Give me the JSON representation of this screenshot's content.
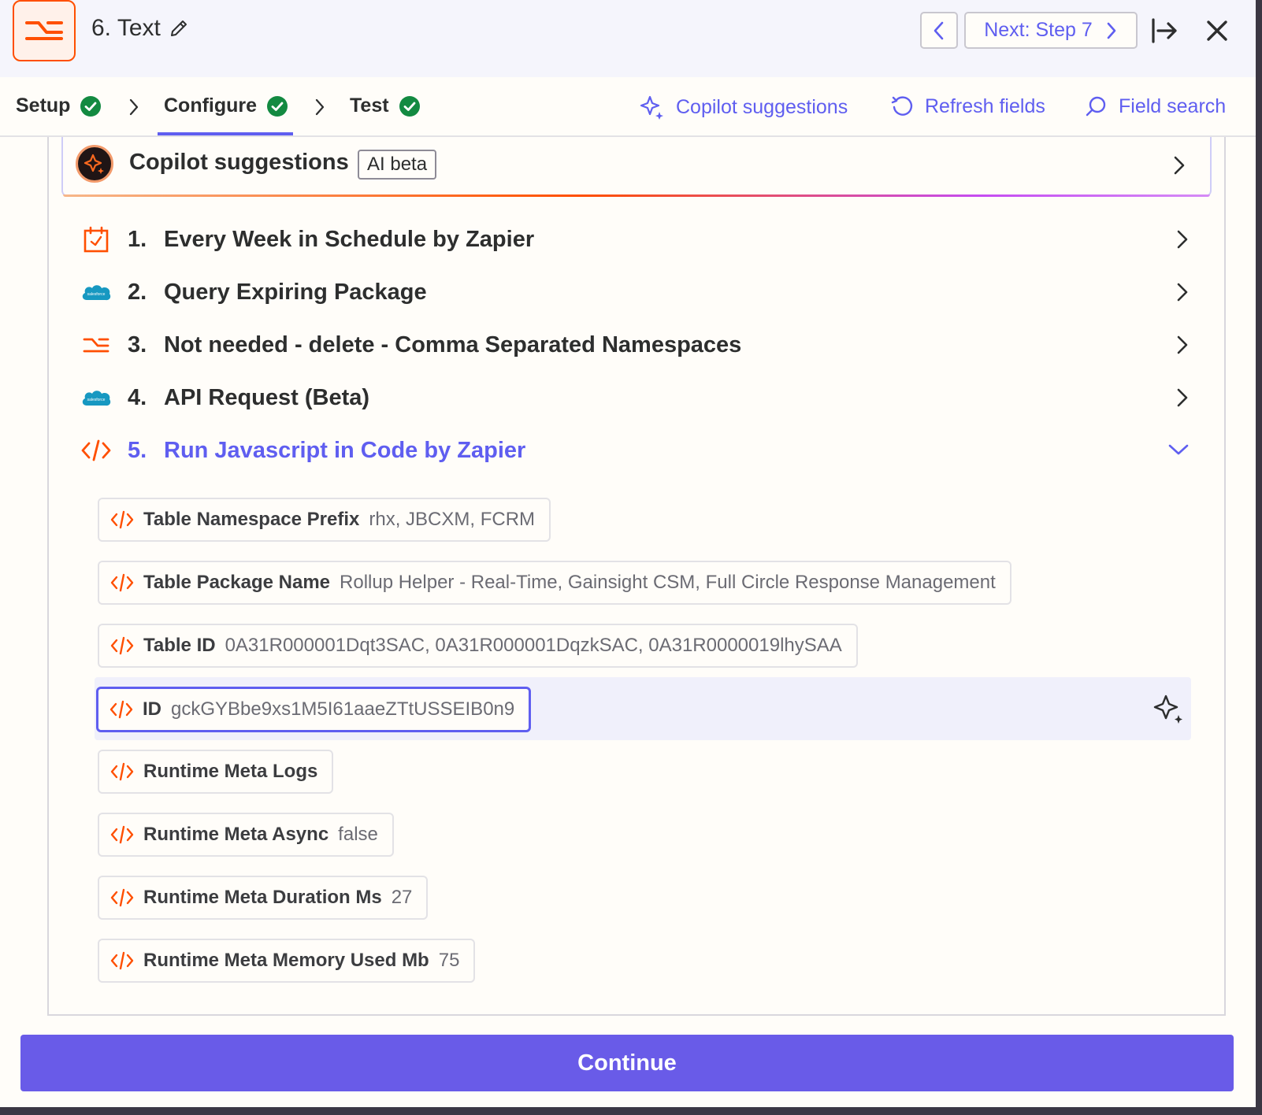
{
  "header": {
    "title": "6. Text",
    "next_label": "Next: Step 7"
  },
  "tabs": [
    {
      "label": "Setup",
      "status": "complete"
    },
    {
      "label": "Configure",
      "status": "complete"
    },
    {
      "label": "Test",
      "status": "complete"
    }
  ],
  "tools": {
    "copilot": "Copilot suggestions",
    "refresh": "Refresh fields",
    "search": "Field search"
  },
  "copilot_card": {
    "title": "Copilot suggestions",
    "badge": "AI beta"
  },
  "steps": [
    {
      "num": "1.",
      "label": "Every Week in Schedule by Zapier",
      "icon": "schedule-icon",
      "expanded": false
    },
    {
      "num": "2.",
      "label": "Query Expiring Package",
      "icon": "salesforce-icon",
      "expanded": false
    },
    {
      "num": "3.",
      "label": "Not needed - delete - Comma Separated Namespaces",
      "icon": "formatter-icon",
      "expanded": false
    },
    {
      "num": "4.",
      "label": "API Request (Beta)",
      "icon": "salesforce-icon",
      "expanded": false
    },
    {
      "num": "5.",
      "label": "Run Javascript in Code by Zapier",
      "icon": "code-icon",
      "expanded": true
    }
  ],
  "fields": [
    {
      "label": "Table Namespace Prefix",
      "value": "rhx, JBCXM, FCRM"
    },
    {
      "label": "Table Package Name",
      "value": "Rollup Helper - Real-Time, Gainsight CSM, Full Circle Response Management"
    },
    {
      "label": "Table ID",
      "value": "0A31R000001Dqt3SAC, 0A31R000001DqzkSAC, 0A31R0000019lhySAA"
    },
    {
      "label": "ID",
      "value": "gckGYBbe9xs1M5I61aaeZTtUSSEIB0n9",
      "selected": true
    },
    {
      "label": "Runtime Meta Logs",
      "value": ""
    },
    {
      "label": "Runtime Meta Async",
      "value": "false"
    },
    {
      "label": "Runtime Meta Duration Ms",
      "value": "27"
    },
    {
      "label": "Runtime Meta Memory Used Mb",
      "value": "75"
    }
  ],
  "footer": {
    "continue_label": "Continue"
  },
  "colors": {
    "accent": "#5f5ef0",
    "brand_orange": "#ff4f00",
    "success": "#138a41",
    "continue_bg": "#695be8",
    "salesforce_blue": "#1798c1"
  }
}
